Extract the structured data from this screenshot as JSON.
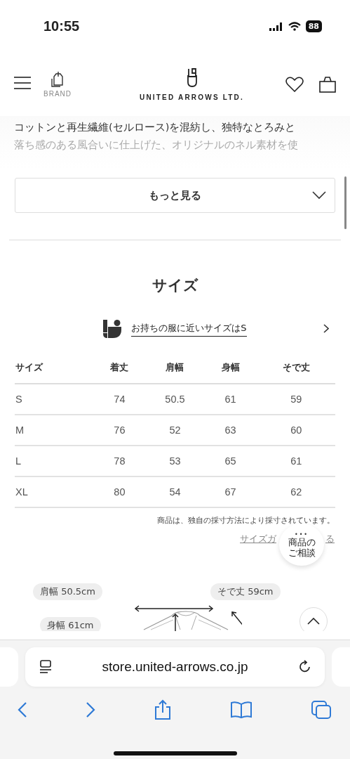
{
  "status_bar": {
    "time": "10:55",
    "battery": "88"
  },
  "header": {
    "brand_label": "BRAND",
    "logo_text": "UNITED ARROWS LTD."
  },
  "description": {
    "lines": [
      {
        "text": "コットンと再生繊維(セルロース)を混紡し、独特なとろみと",
        "faded": false
      },
      {
        "text": "落ち感のある風合いに仕上げた、オリジナルのネル素材を使",
        "faded": true
      }
    ]
  },
  "more_button": {
    "label": "もっと見る",
    "expanded": false
  },
  "size_section": {
    "title": "サイズ",
    "fit_link": "お持ちの服に近いサイズはS",
    "table": {
      "columns": [
        "サイズ",
        "着丈",
        "肩幅",
        "身幅",
        "そで丈"
      ],
      "rows": [
        [
          "S",
          "74",
          "50.5",
          "61",
          "59"
        ],
        [
          "M",
          "76",
          "52",
          "63",
          "60"
        ],
        [
          "L",
          "78",
          "53",
          "65",
          "61"
        ],
        [
          "XL",
          "80",
          "54",
          "67",
          "62"
        ]
      ]
    },
    "note": "商品は、独自の採寸方法により採寸されています。",
    "guide_link": {
      "visible_start": "サイズガ",
      "visible_end": "る"
    }
  },
  "consult_button": {
    "dots": "•••",
    "label_lines": [
      "商品の",
      "ご相談"
    ]
  },
  "diagram": {
    "labels": [
      {
        "text": "肩幅 50.5cm"
      },
      {
        "text": "そで丈 59cm"
      },
      {
        "text": "身幅 61cm"
      }
    ]
  },
  "browser": {
    "url": "store.united-arrows.co.jp"
  }
}
